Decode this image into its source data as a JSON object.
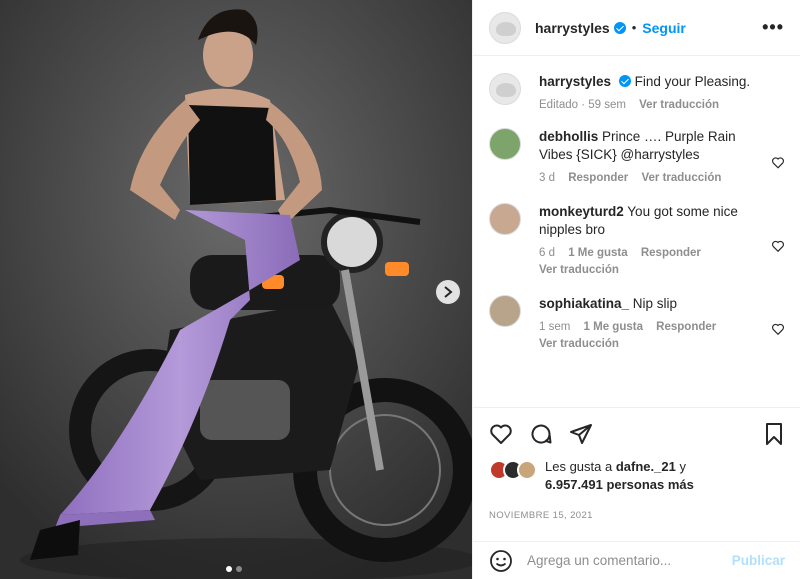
{
  "post": {
    "username": "harrystyles",
    "follow_label": "Seguir",
    "more_label": "•••"
  },
  "caption": {
    "username": "harrystyles",
    "text": "Find your Pleasing.",
    "edited": "Editado · 59 sem",
    "translate": "Ver traducción"
  },
  "comments": [
    {
      "username": "debhollis",
      "text": "Prince …. Purple Rain Vibes {SICK} @harrystyles",
      "time": "3 d",
      "likes": "",
      "reply": "Responder",
      "translate": "Ver traducción"
    },
    {
      "username": "monkeyturd2",
      "text": "You got some nice nipples bro",
      "time": "6 d",
      "likes": "1 Me gusta",
      "reply": "Responder",
      "translate": "Ver traducción"
    },
    {
      "username": "sophiakatina_",
      "text": "Nip slip",
      "time": "1 sem",
      "likes": "1 Me gusta",
      "reply": "Responder",
      "translate": "Ver traducción"
    }
  ],
  "likes": {
    "prefix": "Les gusta a",
    "user": "dafne._21",
    "joiner": "y",
    "count": "6.957.491 personas más"
  },
  "date": "NOVIEMBRE 15, 2021",
  "comment_box": {
    "placeholder": "Agrega un comentario...",
    "publish_label": "Publicar"
  },
  "carousel": {
    "slides": 2,
    "active": 1
  },
  "colors": {
    "accent": "#0095f6",
    "muted": "#8e8e8e",
    "publish_disabled": "#b2dffc",
    "pants": "#a88bd0"
  },
  "icons": [
    "more-icon",
    "verified-icon",
    "heart-icon",
    "comment-icon",
    "share-icon",
    "bookmark-icon",
    "emoji-icon",
    "chevron-right-icon"
  ]
}
